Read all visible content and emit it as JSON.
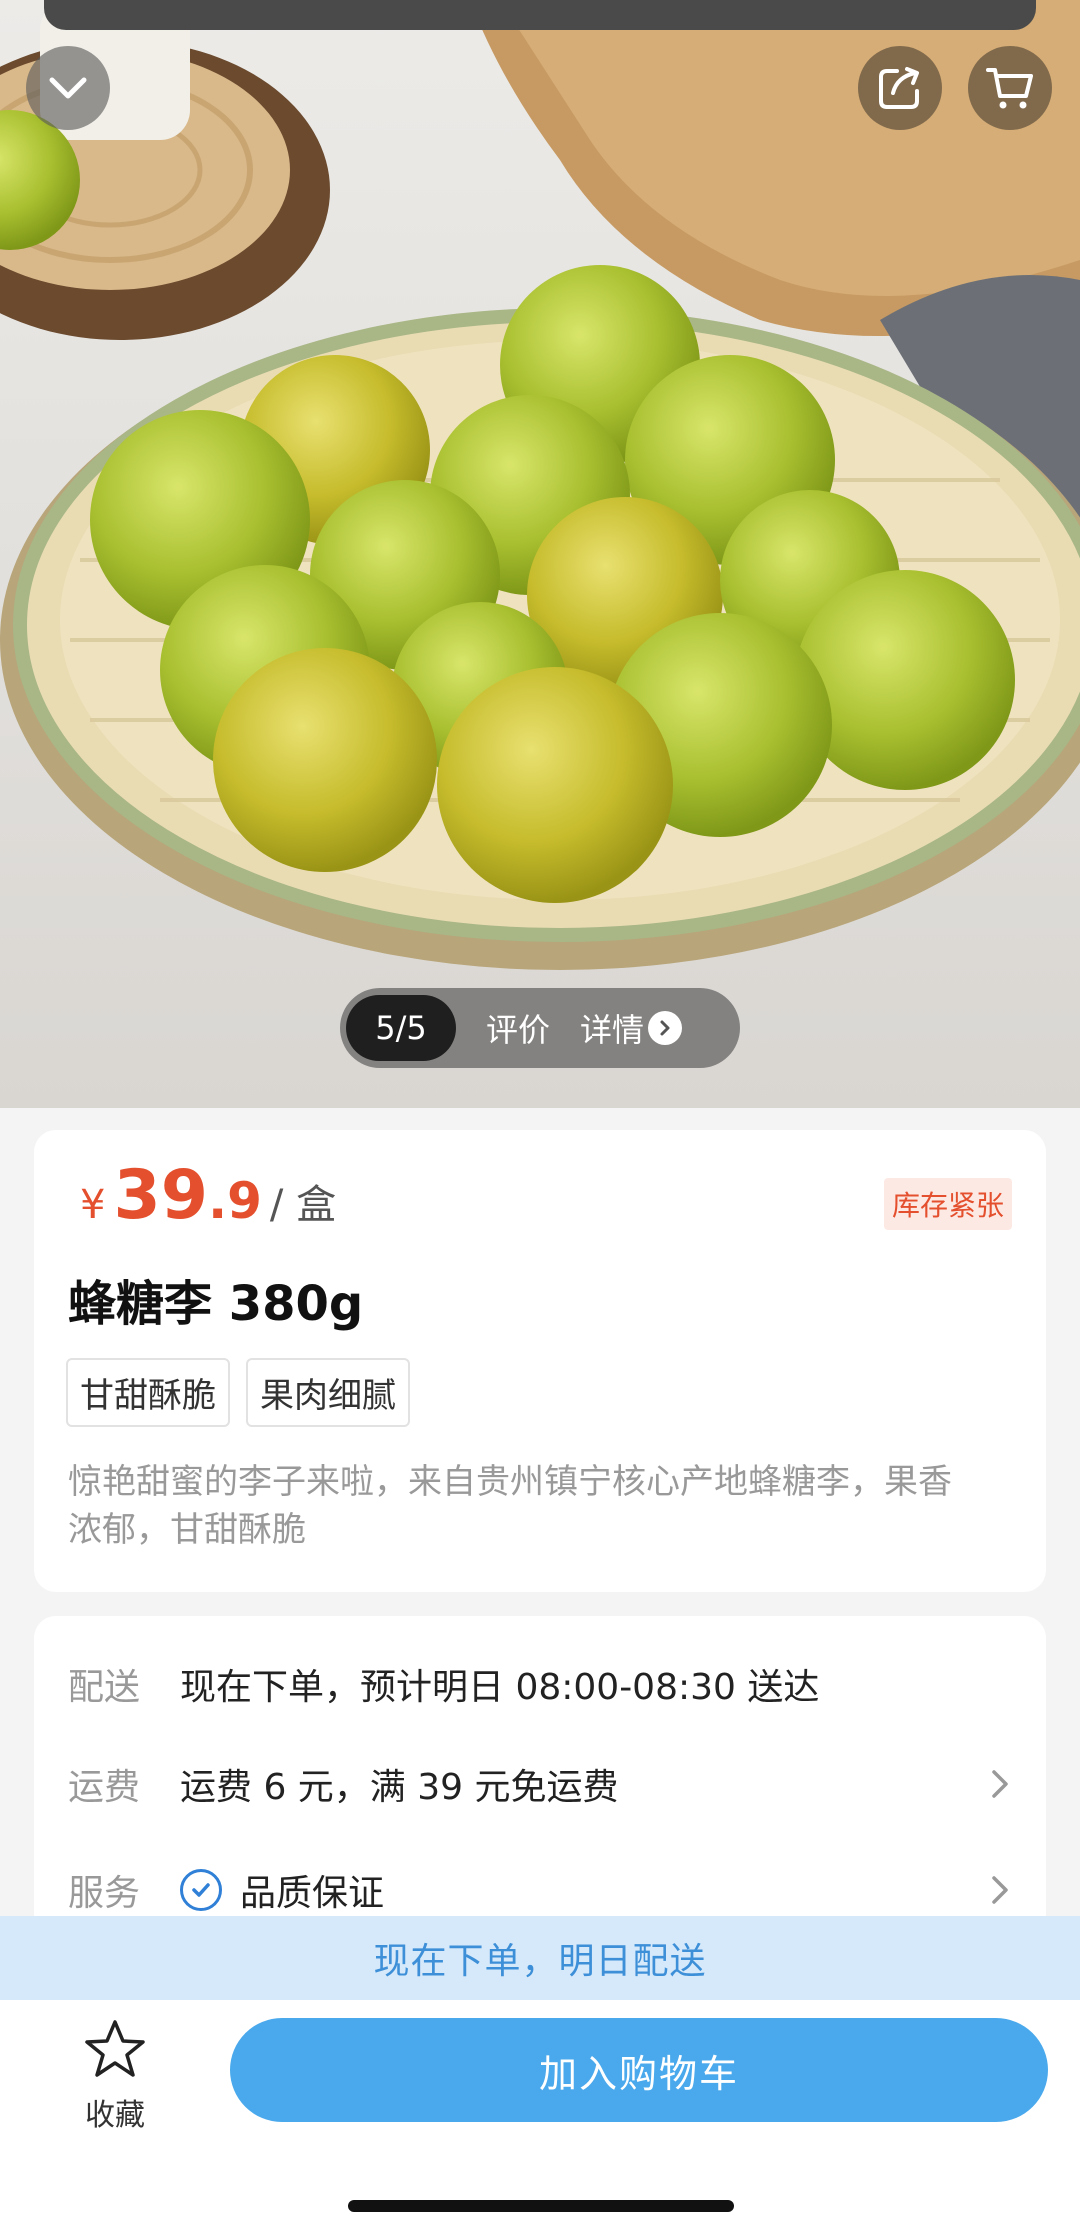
{
  "gallery": {
    "counter": "5/5",
    "tabs": [
      "评价",
      "详情"
    ]
  },
  "product": {
    "currency": "¥",
    "price_int": "39",
    "price_dec": ".9",
    "unit": "/ 盒",
    "stock_badge": "库存紧张",
    "title": "蜂糖李 380g",
    "tags": [
      "甘甜酥脆",
      "果肉细腻"
    ],
    "description": "惊艳甜蜜的李子来啦，来自贵州镇宁核心产地蜂糖李，果香浓郁，甘甜酥脆"
  },
  "delivery": {
    "rows": [
      {
        "label": "配送",
        "value": "现在下单，预计明日 08:00-08:30 送达"
      },
      {
        "label": "运费",
        "value": "运费 6 元，满 39 元免运费"
      },
      {
        "label": "服务",
        "value": "品质保证"
      }
    ]
  },
  "banner": "现在下单，明日配送",
  "bottom": {
    "favorite_label": "收藏",
    "add_to_cart": "加入购物车"
  },
  "colors": {
    "price": "#e4502e",
    "accent_blue": "#4aa9ec",
    "banner_bg": "#d6e9fa"
  },
  "icons": [
    "chevron-down-icon",
    "share-icon",
    "cart-icon",
    "chevron-right-icon",
    "check-circle-icon",
    "star-icon"
  ]
}
